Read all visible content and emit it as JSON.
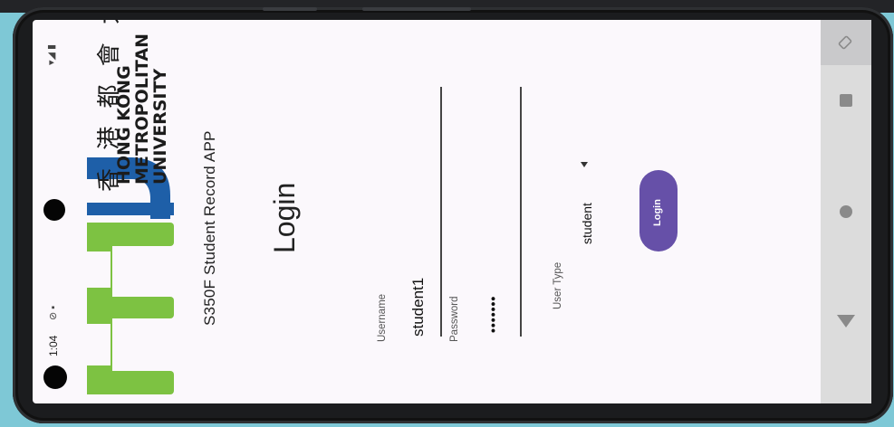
{
  "status_bar": {
    "time": "1:04",
    "icons": "⊘ ▪",
    "right_icons": "▾◢ ▮"
  },
  "logo": {
    "brand": "mu",
    "chinese_name": "香 港 都 會 大 學",
    "english_line1": "HONG KONG",
    "english_line2": "METROPOLITAN",
    "english_line3": "UNIVERSITY",
    "colors": {
      "green": "#7dc242",
      "blue": "#1e5fa8"
    }
  },
  "app": {
    "subtitle": "S350F Student Record APP",
    "title": "Login"
  },
  "form": {
    "username": {
      "label": "Username",
      "value": "student1"
    },
    "password": {
      "label": "Password",
      "value": "•••••••"
    },
    "user_type": {
      "label": "User Type",
      "value": "student"
    },
    "login_button": {
      "label": "Login",
      "color": "#6650a8"
    }
  },
  "nav_bar": {
    "icons": [
      "rotate-icon",
      "square-icon",
      "circle-icon",
      "back-triangle-icon"
    ]
  }
}
